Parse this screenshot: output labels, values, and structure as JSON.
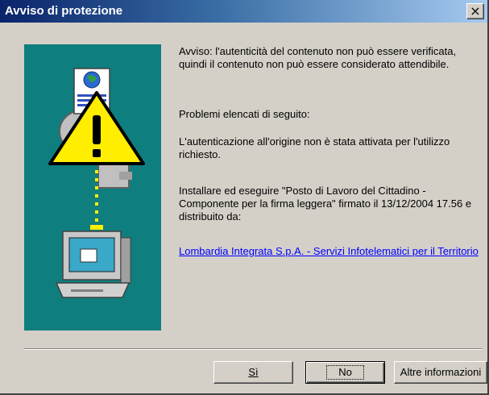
{
  "window": {
    "title": "Avviso di protezione",
    "close_symbol": "×"
  },
  "illustration": {
    "icons": [
      "document-globe-icon",
      "warning-icon",
      "computer-icon",
      "key-icon"
    ],
    "background_color": "#0f7e7e"
  },
  "message": {
    "p1": "Avviso: l'autenticità del contenuto non può essere verificata, quindi il contenuto non può essere considerato attendibile.",
    "p2": "Problemi elencati di seguito:",
    "p3": "L'autenticazione all'origine non è stata attivata per l'utilizzo richiesto.",
    "p4": "Installare ed eseguire \"Posto di Lavoro del Cittadino - Componente per la firma leggera\" firmato il 13/12/2004 17.56 e distribuito da:",
    "link": "Lombardia Integrata S.p.A. - Servizi Infotelematici per il Territorio"
  },
  "buttons": {
    "yes": "Sì",
    "no": "No",
    "more_info": "Altre informazioni"
  }
}
